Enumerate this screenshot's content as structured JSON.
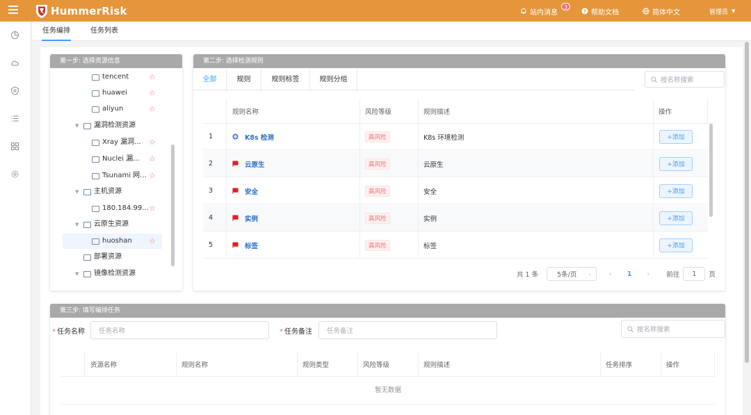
{
  "topbar": {
    "brand": "HummerRisk",
    "messages_label": "站内消息",
    "messages_count": "3",
    "help_label": "帮助文档",
    "language_label": "简体中文",
    "user_label": "管理员",
    "bg_color": "#e5963a"
  },
  "tabs": [
    {
      "label": "任务编排",
      "active": true
    },
    {
      "label": "任务列表",
      "active": false
    }
  ],
  "rail_icons": [
    "dashboard-icon",
    "cloud-icon",
    "shield-icon",
    "list-icon",
    "apps-icon",
    "settings-icon"
  ],
  "step1": {
    "title": "第一步: 选择资源信息",
    "tree": [
      {
        "label": "tencent",
        "level": 3,
        "star": true
      },
      {
        "label": "huawei",
        "level": 3,
        "star": true
      },
      {
        "label": "aliyun",
        "level": 3,
        "star": true
      },
      {
        "label": "漏洞检测资源",
        "level": 2,
        "expanded": true
      },
      {
        "label": "Xray 漏洞...",
        "level": 3,
        "star": true
      },
      {
        "label": "Nuclei 漏...",
        "level": 3,
        "star": true
      },
      {
        "label": "Tsunami 网...",
        "level": 3,
        "star": true
      },
      {
        "label": "主机资源",
        "level": 2,
        "expanded": true
      },
      {
        "label": "180.184.99...",
        "level": 3,
        "star": true
      },
      {
        "label": "云原生资源",
        "level": 2,
        "expanded": true
      },
      {
        "label": "huoshan",
        "level": 3,
        "star": true,
        "selected": true
      },
      {
        "label": "部署资源",
        "level": 2,
        "expanded": false
      },
      {
        "label": "镜像检测资源",
        "level": 2,
        "expanded": true
      }
    ]
  },
  "step2": {
    "title": "第二步: 选择检测规则",
    "tabs": [
      "全部",
      "规则",
      "规则标签",
      "规则分组"
    ],
    "active_tab": "全部",
    "search_placeholder": "按名称搜索",
    "columns": [
      "规则名称",
      "风险等级",
      "规则描述",
      "操作"
    ],
    "rows": [
      {
        "index": "1",
        "name": "K8s 检测",
        "icon": "k8s-icon",
        "risk": "高风险",
        "desc": "K8s 环境检测",
        "action": "+添加"
      },
      {
        "index": "2",
        "name": "云原生",
        "icon": "flag-icon",
        "risk": "高风险",
        "desc": "云原生",
        "action": "+添加"
      },
      {
        "index": "3",
        "name": "安全",
        "icon": "flag-icon",
        "risk": "高风险",
        "desc": "安全",
        "action": "+添加"
      },
      {
        "index": "4",
        "name": "实例",
        "icon": "flag-icon",
        "risk": "高风险",
        "desc": "实例",
        "action": "+添加"
      },
      {
        "index": "5",
        "name": "标签",
        "icon": "flag-icon",
        "risk": "高风险",
        "desc": "标签",
        "action": "+添加"
      }
    ],
    "pagination": {
      "total_text": "共 1 条",
      "page_size": "5条/页",
      "current_page": "1",
      "goto_label": "前往",
      "goto_value": "1",
      "page_unit": "页"
    }
  },
  "step3": {
    "title": "第三步: 填写编排任务",
    "task_name_label": "任务名称",
    "task_name_placeholder": "任务名称",
    "task_note_label": "任务备注",
    "task_note_placeholder": "任务备注",
    "search_placeholder": "按名称搜索",
    "columns": [
      "资源名称",
      "规则名称",
      "规则类型",
      "风险等级",
      "规则描述",
      "任务排序",
      "操作"
    ],
    "empty_text": "暂无数据"
  }
}
